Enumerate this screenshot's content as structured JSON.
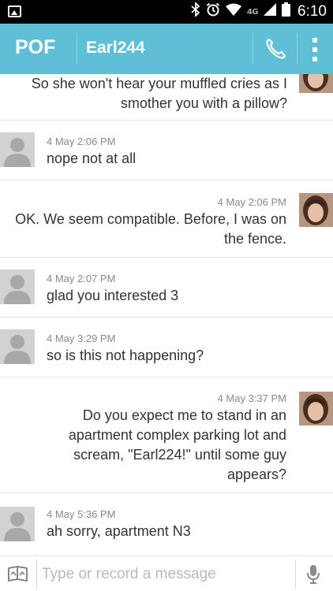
{
  "status_bar": {
    "time": "6:10",
    "network_label": "4G",
    "icons": [
      "gallery-notification-icon",
      "bluetooth-icon",
      "alarm-clock-icon",
      "wifi-icon",
      "signal-icon",
      "battery-icon"
    ]
  },
  "header": {
    "logo": "POF",
    "contact_name": "Earl244",
    "accent_color": "#5fbfd6",
    "actions": [
      "phone-icon",
      "overflow-menu-icon"
    ]
  },
  "messages": [
    {
      "sender": "self",
      "time": "",
      "lines": [
        "So she won't hear your muffled cries as I",
        "smother you with a pillow?"
      ]
    },
    {
      "sender": "other",
      "time": "4 May 2:06 PM",
      "lines": [
        "nope not at all"
      ]
    },
    {
      "sender": "self",
      "time": "4 May 2:06 PM",
      "lines": [
        "OK. We seem compatible. Before, I was on",
        "the fence."
      ]
    },
    {
      "sender": "other",
      "time": "4 May 2:07 PM",
      "lines": [
        "glad you interested 3"
      ]
    },
    {
      "sender": "other",
      "time": "4 May 3:29 PM",
      "lines": [
        "so is this not happening?"
      ]
    },
    {
      "sender": "self",
      "time": "4 May 3:37 PM",
      "lines": [
        "Do you expect me to stand in an",
        "apartment complex parking lot and",
        "scream, \"Earl224!\" until some guy",
        "appears?"
      ]
    },
    {
      "sender": "other",
      "time": "4 May 5:36 PM",
      "lines": [
        "ah sorry, apartment N3"
      ]
    }
  ],
  "composer": {
    "placeholder": "Type or record a message",
    "value": ""
  }
}
